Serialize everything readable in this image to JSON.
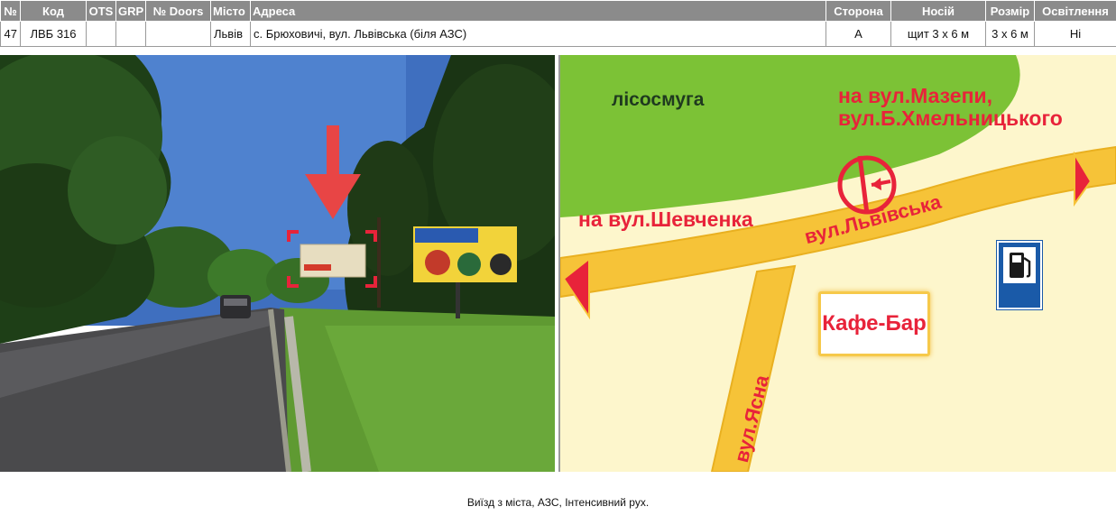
{
  "table": {
    "headers": {
      "num": "№",
      "code": "Код",
      "ots": "OTS",
      "grp": "GRP",
      "doors": "№ Doors",
      "city": "Місто",
      "address": "Адреса",
      "side": "Сторона",
      "carrier": "Носій",
      "size": "Розмір",
      "light": "Освітлення"
    },
    "row": {
      "num": "47",
      "code": "ЛВБ 316",
      "ots": "",
      "grp": "",
      "doors": "",
      "city": "Львів",
      "address": "с. Брюховичі, вул. Львівська (біля АЗС)",
      "side": "A",
      "carrier": "щит 3 x 6 м",
      "size": "3 x 6 м",
      "light": "Ні"
    }
  },
  "map": {
    "forest_label": "лісосмуга",
    "mazepy_line1": "на вул.Мазепи,",
    "mazepy_line2": "вул.Б.Хмельницького",
    "shevchenka": "на вул.Шевченка",
    "lvivska": "вул.Львівська",
    "yasna": "вул.Ясна",
    "cafe": "Кафе-Бар",
    "gas_icon": "gas-station-icon",
    "colors": {
      "road": "#f6c338",
      "forest": "#7cc236",
      "label": "#e8233a",
      "background": "#fdf6cc"
    }
  },
  "photo": {
    "marker_icon": "red-down-arrow-icon"
  },
  "caption": "Виїзд з міста, АЗС, Інтенсивний рух."
}
